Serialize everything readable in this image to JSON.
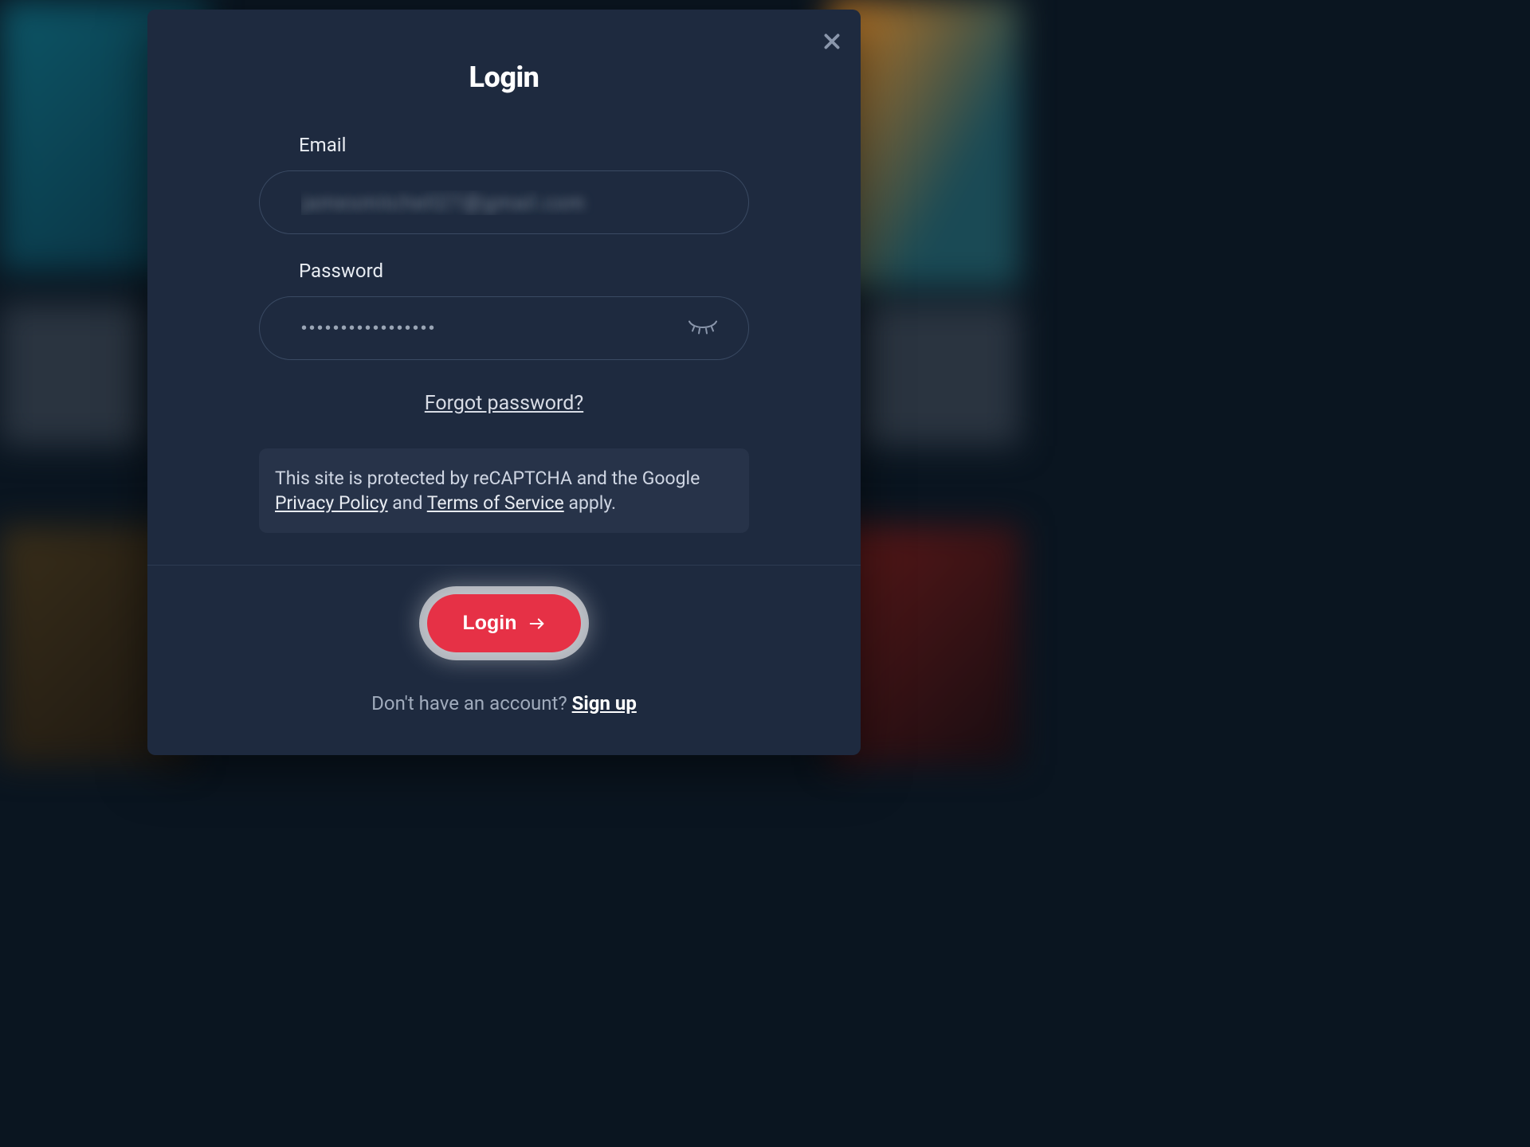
{
  "modal": {
    "title": "Login",
    "form": {
      "email": {
        "label": "Email",
        "value": "jamesmitchell27@gmail.com"
      },
      "password": {
        "label": "Password",
        "value": "•••••••••••••••••"
      },
      "forgot": "Forgot password?",
      "recaptcha": {
        "prefix": "This site is protected by reCAPTCHA and the Google ",
        "privacy": "Privacy Policy",
        "mid": " and ",
        "tos": "Terms of Service",
        "suffix": " apply."
      }
    },
    "footer": {
      "loginLabel": "Login",
      "promptPrefix": "Don't have an account? ",
      "signup": "Sign up"
    }
  }
}
